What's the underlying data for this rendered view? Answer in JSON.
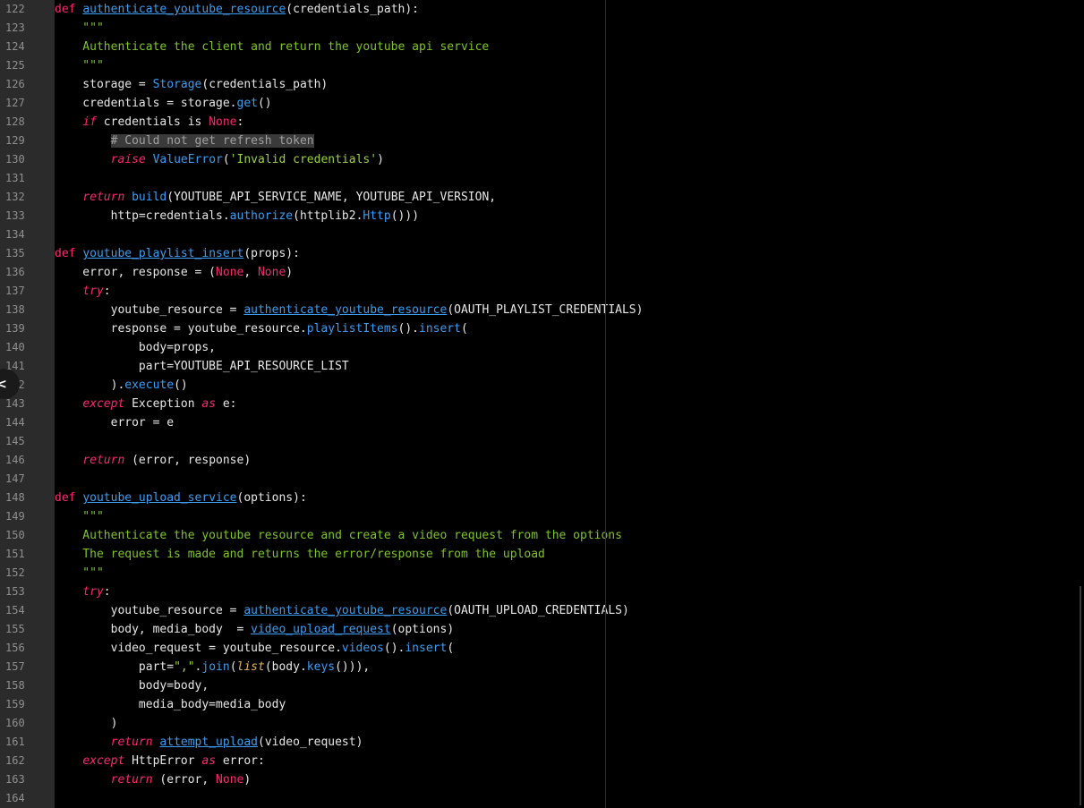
{
  "editor": {
    "accent_color": "#3d9df3",
    "keyword_color": "#f92672",
    "string_color": "#9ad13e",
    "background": "#000000",
    "gutter_background": "#2b2b2b",
    "collapse_icon": "chevron-left-icon",
    "collapse_glyph": "<",
    "lines": [
      {
        "n": "122",
        "tokens": [
          {
            "t": "def",
            "c": "kw"
          },
          {
            "t": " ",
            "c": "nm"
          },
          {
            "t": "authenticate_youtube_resource",
            "c": "fnd"
          },
          {
            "t": "(credentials_path):",
            "c": "nm"
          }
        ]
      },
      {
        "n": "123",
        "tokens": [
          {
            "t": "    \"\"\"",
            "c": "doc"
          }
        ]
      },
      {
        "n": "124",
        "tokens": [
          {
            "t": "    Authenticate the client and return the youtube api service",
            "c": "doc"
          }
        ]
      },
      {
        "n": "125",
        "tokens": [
          {
            "t": "    \"\"\"",
            "c": "doc"
          }
        ]
      },
      {
        "n": "126",
        "tokens": [
          {
            "t": "    storage = ",
            "c": "nm"
          },
          {
            "t": "Storage",
            "c": "fn"
          },
          {
            "t": "(credentials_path)",
            "c": "nm"
          }
        ]
      },
      {
        "n": "127",
        "tokens": [
          {
            "t": "    credentials = storage.",
            "c": "nm"
          },
          {
            "t": "get",
            "c": "fn"
          },
          {
            "t": "()",
            "c": "nm"
          }
        ]
      },
      {
        "n": "128",
        "tokens": [
          {
            "t": "    ",
            "c": "nm"
          },
          {
            "t": "if",
            "c": "kwi"
          },
          {
            "t": " credentials is ",
            "c": "nm"
          },
          {
            "t": "None",
            "c": "con"
          },
          {
            "t": ":",
            "c": "nm"
          }
        ]
      },
      {
        "n": "129",
        "tokens": [
          {
            "t": "        ",
            "c": "nm"
          },
          {
            "t": "# Could not get refresh token",
            "c": "cm"
          }
        ]
      },
      {
        "n": "130",
        "tokens": [
          {
            "t": "        ",
            "c": "nm"
          },
          {
            "t": "raise",
            "c": "kwi"
          },
          {
            "t": " ",
            "c": "nm"
          },
          {
            "t": "ValueError",
            "c": "fn"
          },
          {
            "t": "(",
            "c": "nm"
          },
          {
            "t": "'Invalid credentials'",
            "c": "str"
          },
          {
            "t": ")",
            "c": "nm"
          }
        ]
      },
      {
        "n": "131",
        "tokens": []
      },
      {
        "n": "132",
        "tokens": [
          {
            "t": "    ",
            "c": "nm"
          },
          {
            "t": "return",
            "c": "kwi"
          },
          {
            "t": " ",
            "c": "nm"
          },
          {
            "t": "build",
            "c": "fn"
          },
          {
            "t": "(YOUTUBE_API_SERVICE_NAME, YOUTUBE_API_VERSION,",
            "c": "nm"
          }
        ]
      },
      {
        "n": "133",
        "tokens": [
          {
            "t": "        http=credentials.",
            "c": "nm"
          },
          {
            "t": "authorize",
            "c": "fn"
          },
          {
            "t": "(httplib2.",
            "c": "nm"
          },
          {
            "t": "Http",
            "c": "fn"
          },
          {
            "t": "()))",
            "c": "nm"
          }
        ]
      },
      {
        "n": "134",
        "tokens": []
      },
      {
        "n": "135",
        "tokens": [
          {
            "t": "def",
            "c": "kw"
          },
          {
            "t": " ",
            "c": "nm"
          },
          {
            "t": "youtube_playlist_insert",
            "c": "fnd"
          },
          {
            "t": "(props):",
            "c": "nm"
          }
        ]
      },
      {
        "n": "136",
        "tokens": [
          {
            "t": "    error, response = (",
            "c": "nm"
          },
          {
            "t": "None",
            "c": "con"
          },
          {
            "t": ", ",
            "c": "nm"
          },
          {
            "t": "None",
            "c": "con"
          },
          {
            "t": ")",
            "c": "nm"
          }
        ]
      },
      {
        "n": "137",
        "tokens": [
          {
            "t": "    ",
            "c": "nm"
          },
          {
            "t": "try",
            "c": "kwi"
          },
          {
            "t": ":",
            "c": "nm"
          }
        ]
      },
      {
        "n": "138",
        "tokens": [
          {
            "t": "        youtube_resource = ",
            "c": "nm"
          },
          {
            "t": "authenticate_youtube_resource",
            "c": "fnd"
          },
          {
            "t": "(OAUTH_PLAYLIST_CREDENTIALS)",
            "c": "nm"
          }
        ]
      },
      {
        "n": "139",
        "tokens": [
          {
            "t": "        response = youtube_resource.",
            "c": "nm"
          },
          {
            "t": "playlistItems",
            "c": "fn"
          },
          {
            "t": "().",
            "c": "nm"
          },
          {
            "t": "insert",
            "c": "fn"
          },
          {
            "t": "(",
            "c": "nm"
          }
        ]
      },
      {
        "n": "140",
        "tokens": [
          {
            "t": "            body=props,",
            "c": "nm"
          }
        ]
      },
      {
        "n": "141",
        "tokens": [
          {
            "t": "            part=YOUTUBE_API_RESOURCE_LIST",
            "c": "nm"
          }
        ]
      },
      {
        "n": "142",
        "tokens": [
          {
            "t": "        ).",
            "c": "nm"
          },
          {
            "t": "execute",
            "c": "fn"
          },
          {
            "t": "()",
            "c": "nm"
          }
        ]
      },
      {
        "n": "143",
        "tokens": [
          {
            "t": "    ",
            "c": "nm"
          },
          {
            "t": "except",
            "c": "kwi"
          },
          {
            "t": " Exception ",
            "c": "nm"
          },
          {
            "t": "as",
            "c": "kwi"
          },
          {
            "t": " e:",
            "c": "nm"
          }
        ]
      },
      {
        "n": "144",
        "tokens": [
          {
            "t": "        error = e",
            "c": "nm"
          }
        ]
      },
      {
        "n": "145",
        "tokens": []
      },
      {
        "n": "146",
        "tokens": [
          {
            "t": "    ",
            "c": "nm"
          },
          {
            "t": "return",
            "c": "kwi"
          },
          {
            "t": " (error, response)",
            "c": "nm"
          }
        ]
      },
      {
        "n": "147",
        "tokens": []
      },
      {
        "n": "148",
        "tokens": [
          {
            "t": "def",
            "c": "kw"
          },
          {
            "t": " ",
            "c": "nm"
          },
          {
            "t": "youtube_upload_service",
            "c": "fnd"
          },
          {
            "t": "(options):",
            "c": "nm"
          }
        ]
      },
      {
        "n": "149",
        "tokens": [
          {
            "t": "    \"\"\"",
            "c": "doc"
          }
        ]
      },
      {
        "n": "150",
        "tokens": [
          {
            "t": "    Authenticate the youtube resource and create a video request from the options",
            "c": "doc"
          }
        ]
      },
      {
        "n": "151",
        "tokens": [
          {
            "t": "    The request is made and returns the error/response from the upload",
            "c": "doc"
          }
        ]
      },
      {
        "n": "152",
        "tokens": [
          {
            "t": "    \"\"\"",
            "c": "doc"
          }
        ]
      },
      {
        "n": "153",
        "tokens": [
          {
            "t": "    ",
            "c": "nm"
          },
          {
            "t": "try",
            "c": "kwi"
          },
          {
            "t": ":",
            "c": "nm"
          }
        ]
      },
      {
        "n": "154",
        "tokens": [
          {
            "t": "        youtube_resource = ",
            "c": "nm"
          },
          {
            "t": "authenticate_youtube_resource",
            "c": "fnd"
          },
          {
            "t": "(OAUTH_UPLOAD_CREDENTIALS)",
            "c": "nm"
          }
        ]
      },
      {
        "n": "155",
        "tokens": [
          {
            "t": "        body, media_body  = ",
            "c": "nm"
          },
          {
            "t": "video_upload_request",
            "c": "fnd"
          },
          {
            "t": "(options)",
            "c": "nm"
          }
        ]
      },
      {
        "n": "156",
        "tokens": [
          {
            "t": "        video_request = youtube_resource.",
            "c": "nm"
          },
          {
            "t": "videos",
            "c": "fn"
          },
          {
            "t": "().",
            "c": "nm"
          },
          {
            "t": "insert",
            "c": "fn"
          },
          {
            "t": "(",
            "c": "nm"
          }
        ]
      },
      {
        "n": "157",
        "tokens": [
          {
            "t": "            part=",
            "c": "nm"
          },
          {
            "t": "\",\"",
            "c": "str"
          },
          {
            "t": ".",
            "c": "nm"
          },
          {
            "t": "join",
            "c": "fn"
          },
          {
            "t": "(",
            "c": "nm"
          },
          {
            "t": "list",
            "c": "bi"
          },
          {
            "t": "(body.",
            "c": "nm"
          },
          {
            "t": "keys",
            "c": "fn"
          },
          {
            "t": "())),",
            "c": "nm"
          }
        ]
      },
      {
        "n": "158",
        "tokens": [
          {
            "t": "            body=body,",
            "c": "nm"
          }
        ]
      },
      {
        "n": "159",
        "tokens": [
          {
            "t": "            media_body=media_body",
            "c": "nm"
          }
        ]
      },
      {
        "n": "160",
        "tokens": [
          {
            "t": "        )",
            "c": "nm"
          }
        ]
      },
      {
        "n": "161",
        "tokens": [
          {
            "t": "        ",
            "c": "nm"
          },
          {
            "t": "return",
            "c": "kwi"
          },
          {
            "t": " ",
            "c": "nm"
          },
          {
            "t": "attempt_upload",
            "c": "fnd"
          },
          {
            "t": "(video_request)",
            "c": "nm"
          }
        ]
      },
      {
        "n": "162",
        "tokens": [
          {
            "t": "    ",
            "c": "nm"
          },
          {
            "t": "except",
            "c": "kwi"
          },
          {
            "t": " HttpError ",
            "c": "nm"
          },
          {
            "t": "as",
            "c": "kwi"
          },
          {
            "t": " error:",
            "c": "nm"
          }
        ]
      },
      {
        "n": "163",
        "tokens": [
          {
            "t": "        ",
            "c": "nm"
          },
          {
            "t": "return",
            "c": "kwi"
          },
          {
            "t": " (error, ",
            "c": "nm"
          },
          {
            "t": "None",
            "c": "con"
          },
          {
            "t": ")",
            "c": "nm"
          }
        ]
      },
      {
        "n": "164",
        "tokens": []
      }
    ]
  }
}
